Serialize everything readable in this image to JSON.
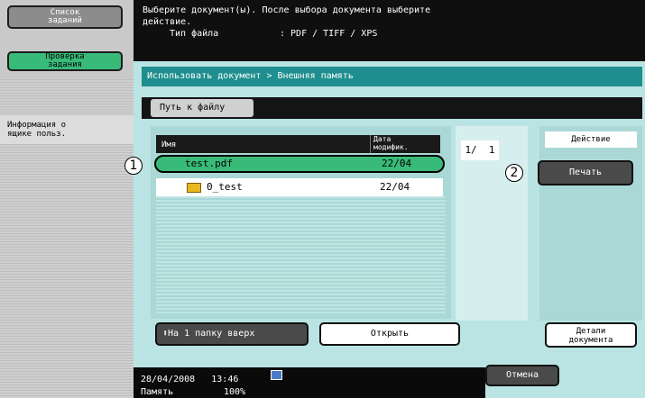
{
  "left": {
    "job_list_label": "Список\nзаданий",
    "check_job_label": "Проверка\nзадания",
    "user_box_info_label": "Информация о\nящике польз."
  },
  "message": {
    "line1": "Выберите документ(ы). После выбора документа выберите",
    "line2": "действие.",
    "filetype_label": "Тип файла",
    "filetype_value": ": PDF / TIFF / XPS"
  },
  "breadcrumb": "Использовать документ > Внешняя память",
  "path_button": "Путь к файлу",
  "file_list": {
    "col_name": "Имя",
    "col_date": "Дата\nмодифик.",
    "rows": [
      {
        "name": "test.pdf",
        "date": "22/04"
      },
      {
        "name": "0_test",
        "date": "22/04"
      }
    ]
  },
  "page_indicator": "1/  1",
  "action": {
    "heading": "Действие",
    "print_label": "Печать",
    "details_label": "Детали\nдокумента"
  },
  "buttons": {
    "up_label": "На 1 папку вверх",
    "open_label": "Открыть",
    "cancel_label": "Отмена"
  },
  "callouts": [
    "1",
    "2"
  ],
  "status": {
    "datetime": "28/04/2008   13:46",
    "memory_label": "Память",
    "memory_value": "100%"
  },
  "colors": {
    "selected_row": "#38bb78",
    "accent_teal": "#1e8e8e",
    "panel_bg": "#b9e4e3"
  }
}
